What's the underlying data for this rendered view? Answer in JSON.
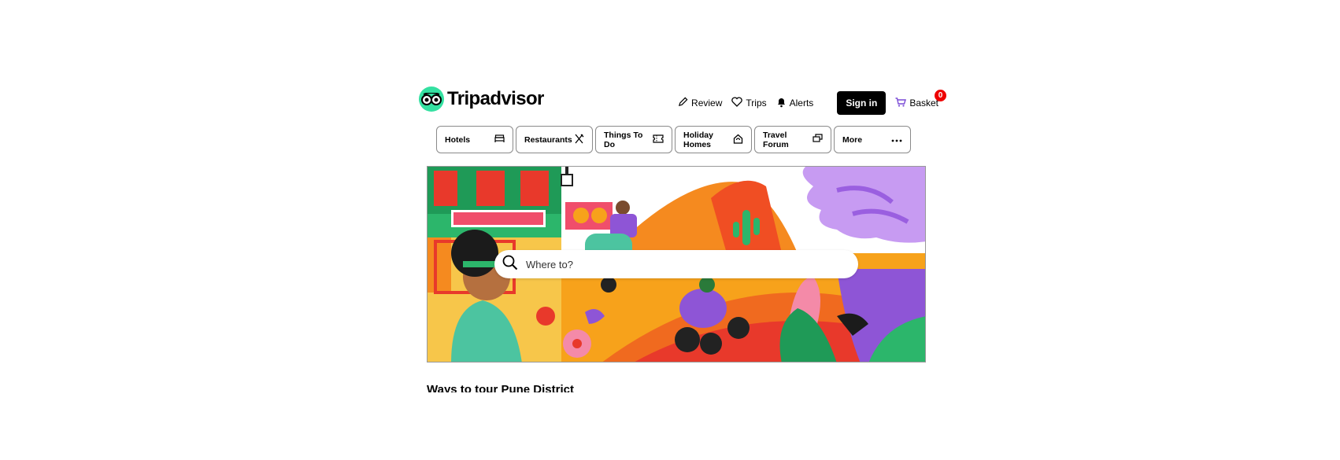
{
  "brand": {
    "name": "Tripadvisor",
    "accent": "#34e0a1"
  },
  "topnav": {
    "review": "Review",
    "trips": "Trips",
    "alerts": "Alerts",
    "sign_in": "Sign in",
    "basket": "Basket",
    "basket_count": "0"
  },
  "categories": [
    {
      "label": "Hotels",
      "icon": "bed-icon"
    },
    {
      "label": "Restaurants",
      "icon": "utensils-icon"
    },
    {
      "label": "Things To Do",
      "icon": "ticket-icon"
    },
    {
      "label": "Holiday Homes",
      "icon": "house-icon"
    },
    {
      "label": "Travel Forum",
      "icon": "chat-icon"
    },
    {
      "label": "More",
      "icon": "ellipsis-icon"
    }
  ],
  "search": {
    "placeholder": "Where to?",
    "icon": "search-icon"
  },
  "section": {
    "title": "Ways to tour Pune District"
  }
}
